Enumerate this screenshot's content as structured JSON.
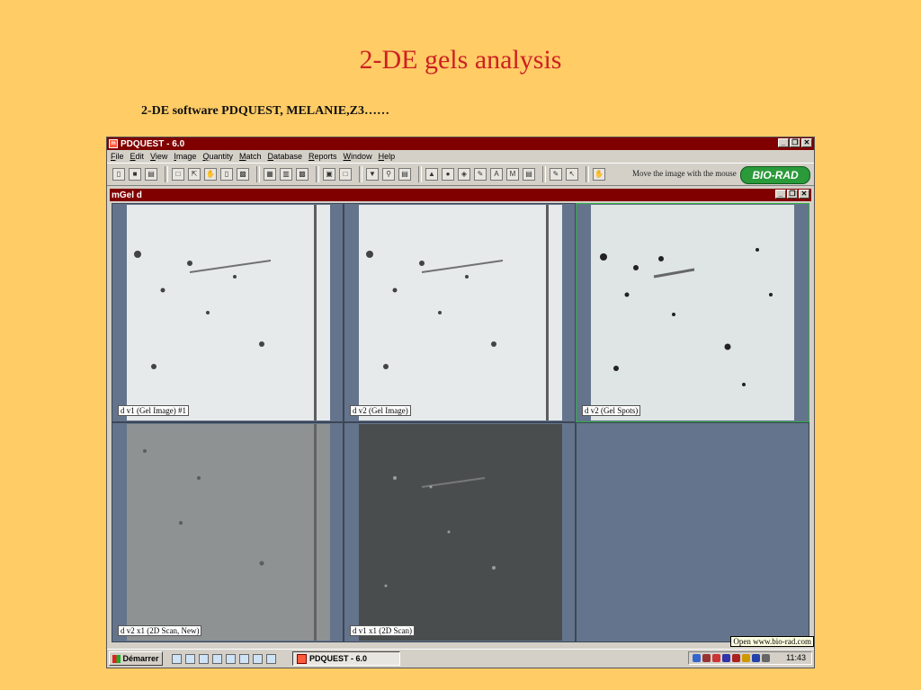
{
  "slide": {
    "title": "2-DE gels analysis",
    "subtitle": "2-DE software PDQUEST, MELANIE,Z3……"
  },
  "app": {
    "title": "PDQUEST - 6.0",
    "menu": [
      "File",
      "Edit",
      "View",
      "Image",
      "Quantity",
      "Match",
      "Database",
      "Reports",
      "Window",
      "Help"
    ],
    "toolbar_message": "Move the image with the mouse",
    "brand": "BIO-RAD",
    "window_buttons": [
      "_",
      "❐",
      "✕"
    ]
  },
  "subwindow": {
    "title": "Gel d",
    "panels": [
      {
        "label": "d v1 (Gel Image) #1",
        "style": "gel-light"
      },
      {
        "label": "d v2 (Gel Image)",
        "style": "gel-light"
      },
      {
        "label": "d v2 (Gel Spots)",
        "style": "gel-spots"
      },
      {
        "label": "d v2 x1 (2D Scan, New)",
        "style": "gel-gray"
      },
      {
        "label": "d v1 x1 (2D Scan)",
        "style": "gel-dark"
      }
    ]
  },
  "taskbar": {
    "start_label": "Démarrer",
    "task_label": "PDQUEST - 6.0",
    "clock": "11:43"
  },
  "tooltip": "Open www.bio-rad.com",
  "colors": {
    "background": "#FFCC66",
    "title_red": "#CC2222",
    "titlebar": "#800000",
    "gel_bg": "#64748c",
    "biorad_green": "#2a9a3a"
  }
}
